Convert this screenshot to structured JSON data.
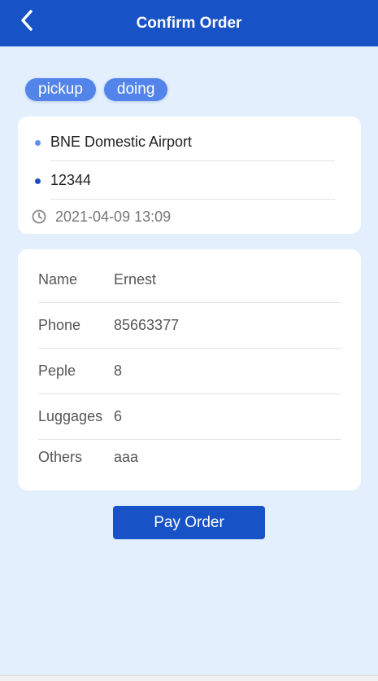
{
  "header": {
    "title": "Confirm Order",
    "back_icon": "chevron-left-icon"
  },
  "tags": [
    "pickup",
    "doing"
  ],
  "route": {
    "from": "BNE Domestic Airport",
    "to": "12344",
    "time": "2021-04-09 13:09",
    "time_icon": "clock-icon"
  },
  "info": [
    {
      "label": "Name",
      "value": "Ernest"
    },
    {
      "label": "Phone",
      "value": "85663377"
    },
    {
      "label": "Peple",
      "value": "8"
    },
    {
      "label": "Luggages",
      "value": "6"
    },
    {
      "label": "Others",
      "value": "aaa"
    }
  ],
  "pay_button": "Pay Order",
  "colors": {
    "primary": "#1752c7",
    "tag": "#5284ea",
    "background": "#e3effd",
    "card": "#ffffff"
  }
}
